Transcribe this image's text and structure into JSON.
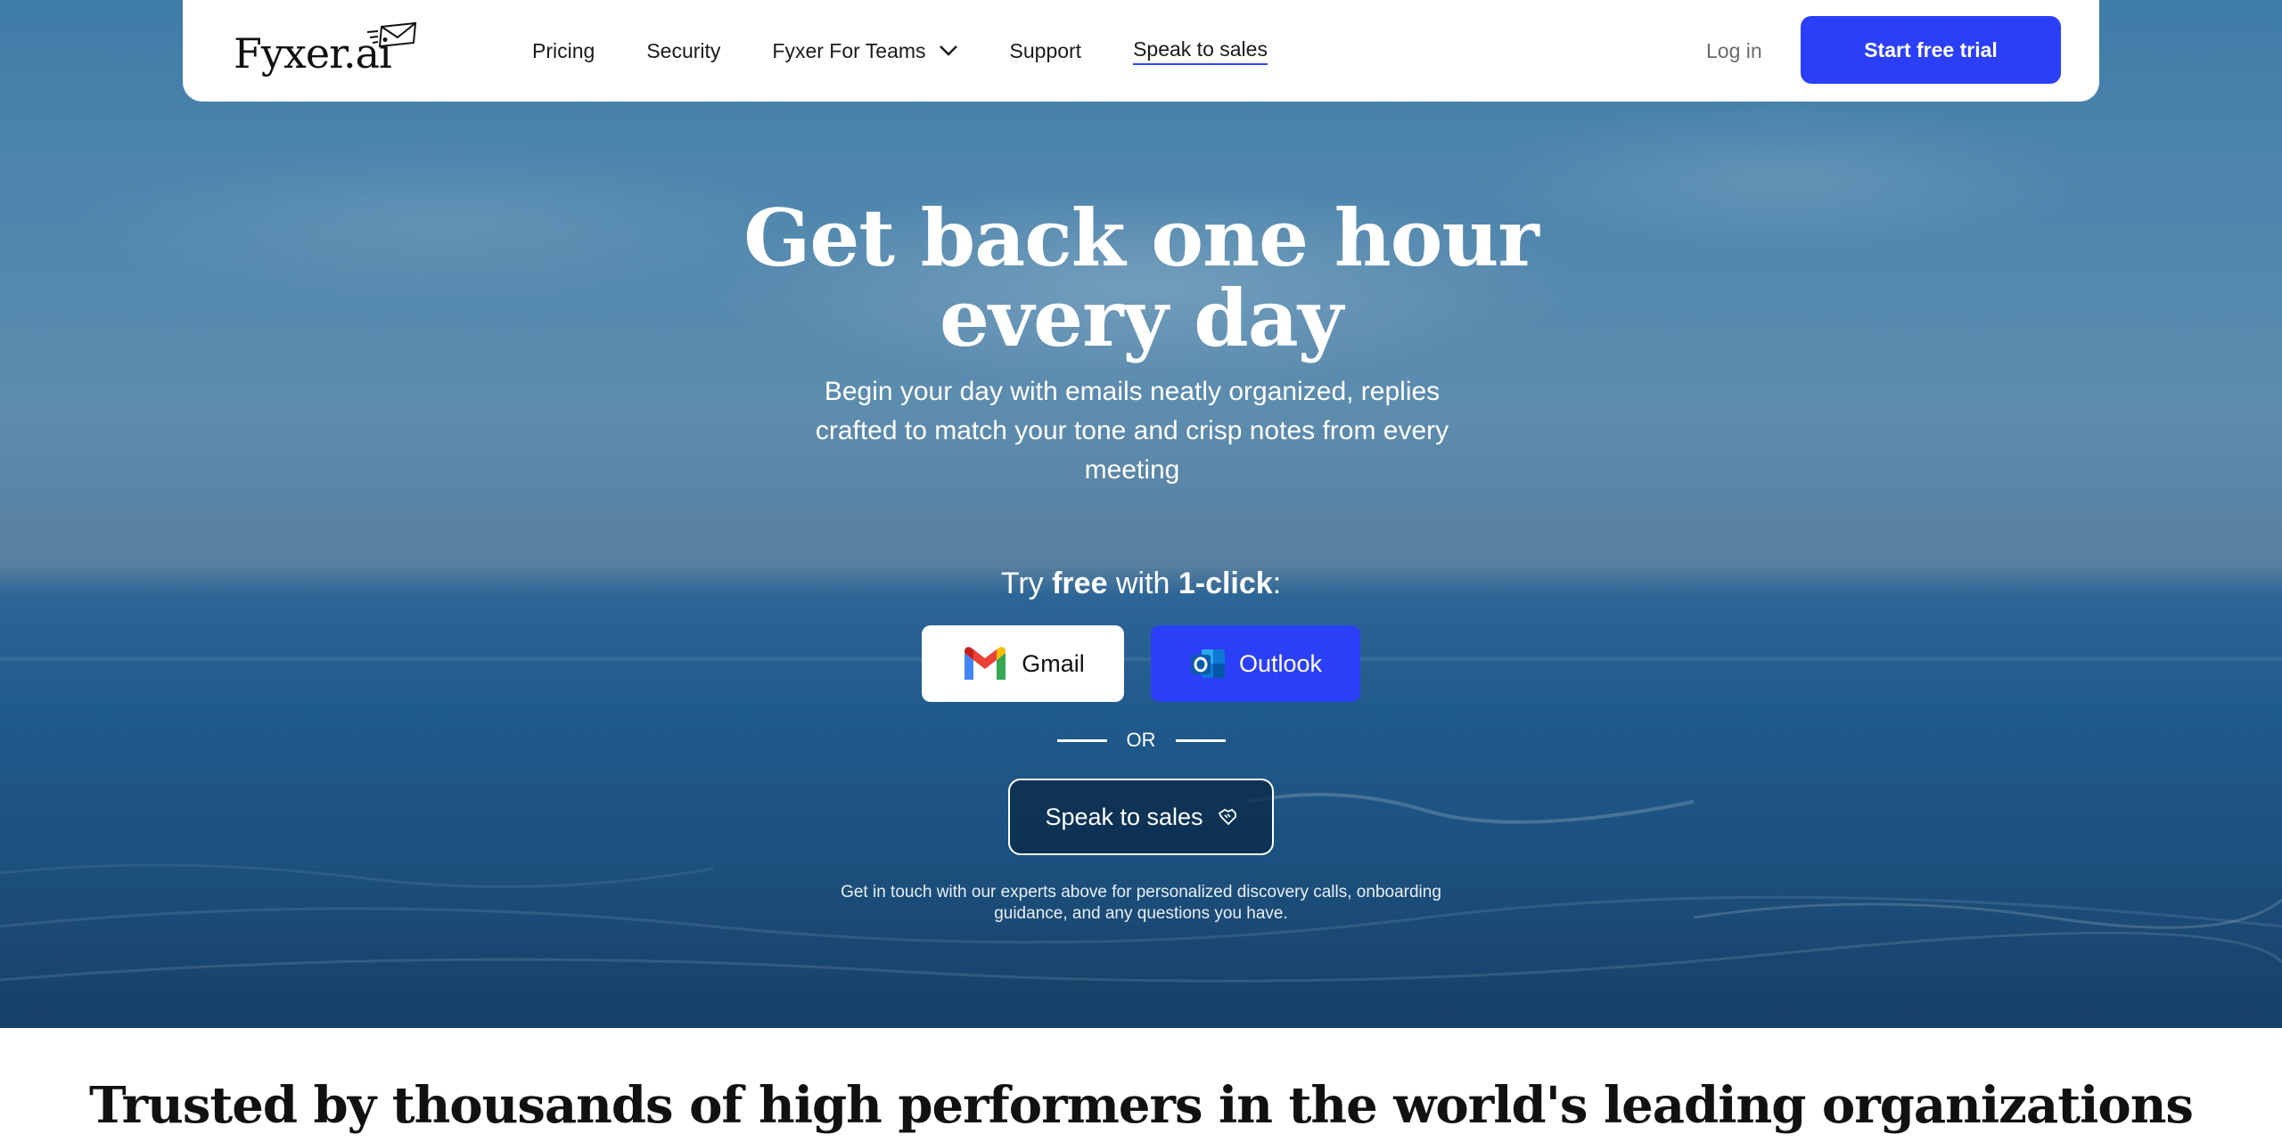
{
  "brand": {
    "logo_text": "Fyxer.ai",
    "accent": "#2b3ff7"
  },
  "nav": {
    "items": [
      {
        "label": "Pricing"
      },
      {
        "label": "Security"
      },
      {
        "label": "Fyxer For Teams"
      },
      {
        "label": "Support"
      },
      {
        "label": "Speak to sales"
      }
    ],
    "login_label": "Log in",
    "trial_label": "Start free trial"
  },
  "hero": {
    "headline_line1": "Get back one hour",
    "headline_line2": "every day",
    "subhead": "Begin your day with emails neatly organized, replies crafted to match your tone and crisp notes from every meeting",
    "try_prefix": "Try ",
    "try_free": "free",
    "try_mid": " with ",
    "try_oneclick": "1-click",
    "try_suffix": ":",
    "gmail_label": "Gmail",
    "outlook_label": "Outlook",
    "or_label": "OR",
    "sales_label": "Speak to sales",
    "sales_note": "Get in touch with our experts above for personalized discovery calls, onboarding guidance, and any questions you have."
  },
  "trusted": {
    "heading": "Trusted by thousands of high performers in the world's leading organizations"
  }
}
